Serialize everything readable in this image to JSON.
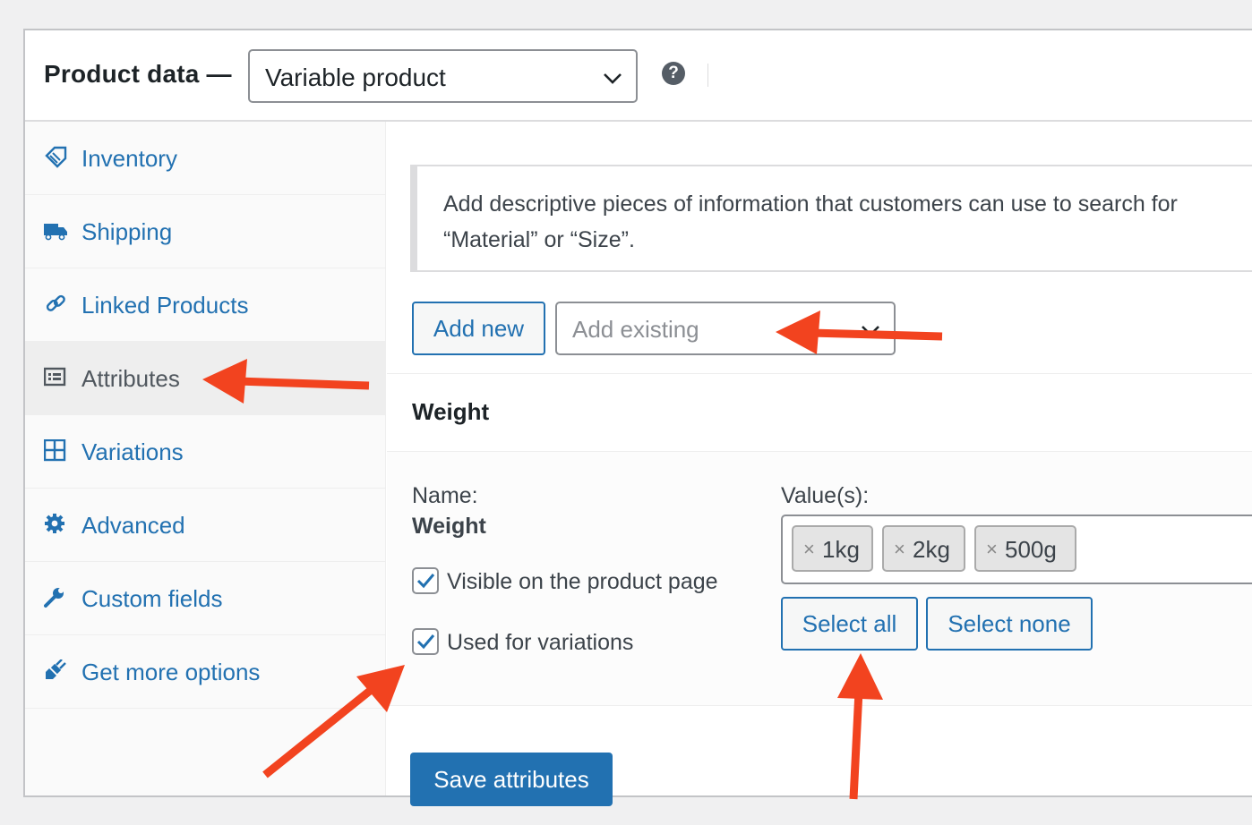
{
  "header": {
    "title": "Product data —",
    "product_type": "Variable product",
    "help_icon": "question-circle-icon"
  },
  "tabs": [
    {
      "label": "Inventory",
      "icon": "tag-icon",
      "active": false
    },
    {
      "label": "Shipping",
      "icon": "truck-icon",
      "active": false
    },
    {
      "label": "Linked Products",
      "icon": "link-icon",
      "active": false
    },
    {
      "label": "Attributes",
      "icon": "list-icon",
      "active": true
    },
    {
      "label": "Variations",
      "icon": "grid-icon",
      "active": false
    },
    {
      "label": "Advanced",
      "icon": "gear-icon",
      "active": false
    },
    {
      "label": "Custom fields",
      "icon": "wrench-icon",
      "active": false
    },
    {
      "label": "Get more options",
      "icon": "plugin-icon",
      "active": false
    }
  ],
  "notice": {
    "line1": "Add descriptive pieces of information that customers can use to search for",
    "line2": "“Material” or “Size”."
  },
  "toolbar": {
    "add_new": "Add new",
    "add_existing_placeholder": "Add existing"
  },
  "attribute": {
    "heading": "Weight",
    "name_label": "Name:",
    "name_value": "Weight",
    "visible_label": "Visible on the product page",
    "visible_checked": true,
    "variations_label": "Used for variations",
    "variations_checked": true,
    "values_label": "Value(s):",
    "values": [
      "1kg",
      "2kg",
      "500g"
    ],
    "remove_glyph": "×",
    "select_all": "Select all",
    "select_none": "Select none"
  },
  "save_button": "Save attributes",
  "colors": {
    "link": "#2271b1",
    "primary": "#2271b1",
    "annotation_arrow": "#f2431f"
  }
}
